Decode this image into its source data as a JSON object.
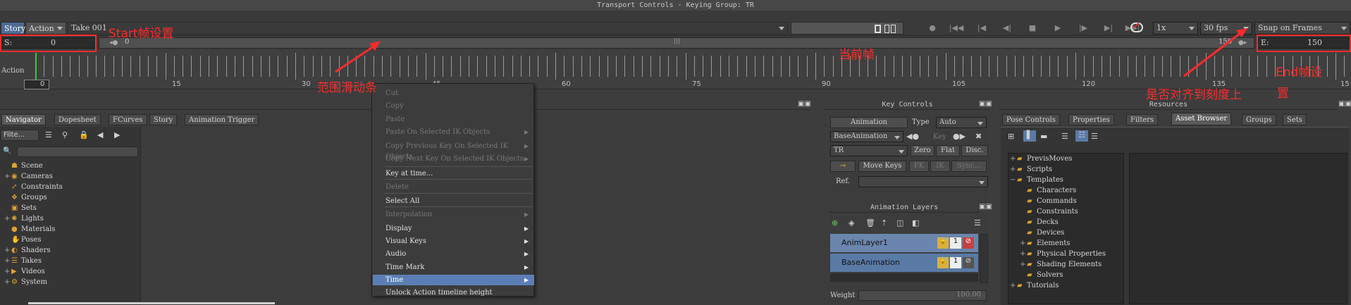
{
  "transport": {
    "title": "Transport Controls  -  Keying Group: TR",
    "story_tab": "Story",
    "action_tab": "Action",
    "take": "Take 001",
    "start_label": "S:",
    "start_value": "0",
    "end_label": "E:",
    "end_value": "150",
    "range_start": "0",
    "range_end": "150",
    "range_mid": "|||",
    "speed": "1x",
    "fps": "30 fps",
    "snap": "Snap on Frames",
    "buttons": {
      "key": "●",
      "to_start": "|◀◀",
      "prev_key": "|◀",
      "prev_frame": "◀|",
      "stop": "■",
      "play": "▶",
      "next_frame": "|▶",
      "next_key": "▶|",
      "to_end": "▶▶|"
    }
  },
  "timeline": {
    "label": "Action",
    "current_frame": "0",
    "ticks": [
      "15",
      "30",
      "45",
      "60",
      "75",
      "90",
      "105",
      "120",
      "135",
      "15"
    ]
  },
  "annotations": {
    "start": "Start帧设置",
    "range": "范围滑动条",
    "current": "当前帧",
    "snap": "是否对齐到刻度上",
    "end_line1": "End帧设",
    "end_line2": "置"
  },
  "navigator": {
    "title": "Navigator",
    "tabs": [
      "Navigator",
      "Dopesheet",
      "FCurves",
      "Story",
      "Animation Trigger"
    ],
    "filter": "Filte...",
    "search_placeholder": "",
    "tree": [
      {
        "label": "Scene",
        "exp": "",
        "icon": "scene-icon"
      },
      {
        "label": "Cameras",
        "exp": "+",
        "icon": "camera-icon"
      },
      {
        "label": "Constraints",
        "exp": "",
        "icon": "constraint-icon"
      },
      {
        "label": "Groups",
        "exp": "",
        "icon": "groups-icon"
      },
      {
        "label": "Sets",
        "exp": "",
        "icon": "sets-icon"
      },
      {
        "label": "Lights",
        "exp": "+",
        "icon": "light-icon"
      },
      {
        "label": "Materials",
        "exp": "",
        "icon": "material-icon"
      },
      {
        "label": "Poses",
        "exp": "",
        "icon": "poses-icon"
      },
      {
        "label": "Shaders",
        "exp": "+",
        "icon": "shader-icon"
      },
      {
        "label": "Takes",
        "exp": "+",
        "icon": "takes-icon"
      },
      {
        "label": "Videos",
        "exp": "+",
        "icon": "video-icon"
      },
      {
        "label": "System",
        "exp": "+",
        "icon": "system-icon"
      }
    ]
  },
  "context_menu": {
    "items": [
      {
        "label": "Cut",
        "disabled": true,
        "sub": false
      },
      {
        "label": "Copy",
        "disabled": true,
        "sub": false
      },
      {
        "label": "Paste",
        "disabled": true,
        "sub": false
      },
      {
        "label": "Paste On Selected IK Objects",
        "disabled": true,
        "sub": true
      },
      {
        "label": "Copy Previous Key On Selected IK Objects",
        "disabled": true,
        "sub": true
      },
      {
        "label": "Copy Next Key On Selected IK Objects",
        "disabled": true,
        "sub": true
      },
      {
        "label": "Key at time...",
        "disabled": false,
        "sub": false
      },
      {
        "label": "Delete",
        "disabled": true,
        "sub": false
      },
      {
        "label": "Select All",
        "disabled": false,
        "sub": false
      },
      {
        "label": "Interpolation",
        "disabled": true,
        "sub": true
      },
      {
        "label": "Display",
        "disabled": false,
        "sub": true
      },
      {
        "label": "Visual Keys",
        "disabled": false,
        "sub": true
      },
      {
        "label": "Audio",
        "disabled": false,
        "sub": true
      },
      {
        "label": "Time Mark",
        "disabled": false,
        "sub": true
      },
      {
        "label": "Time",
        "disabled": false,
        "sub": true,
        "selected": true
      },
      {
        "label": "Unlock Action timeline height",
        "disabled": false,
        "sub": false
      }
    ]
  },
  "key_controls": {
    "title": "Key Controls",
    "mode": "Animation",
    "type_label": "Type",
    "type_value": "Auto",
    "layer": "BaseAnimation",
    "key_label": "Key",
    "group": "TR",
    "zero": "Zero",
    "flat": "Flat",
    "disc": "Disc.",
    "move_keys": "Move Keys",
    "fk": "FK",
    "ik": "IK",
    "sync": "Sync...",
    "ref_label": "Ref.",
    "ref_value": ""
  },
  "animation_layers": {
    "title": "Animation Layers",
    "layers": [
      "AnimLayer1",
      "BaseAnimation"
    ],
    "weight_label": "Weight",
    "weight_value": "100.00"
  },
  "resources": {
    "title": "Resources",
    "tabs": [
      "Pose Controls",
      "Properties",
      "Filters",
      "Asset Browser",
      "Groups",
      "Sets"
    ],
    "active_tab": "Asset Browser",
    "tree": [
      {
        "label": "PrevisMoves",
        "exp": "+",
        "depth": 0
      },
      {
        "label": "Scripts",
        "exp": "+",
        "depth": 0
      },
      {
        "label": "Templates",
        "exp": "−",
        "depth": 0
      },
      {
        "label": "Characters",
        "exp": "",
        "depth": 1
      },
      {
        "label": "Commands",
        "exp": "",
        "depth": 1
      },
      {
        "label": "Constraints",
        "exp": "",
        "depth": 1
      },
      {
        "label": "Decks",
        "exp": "",
        "depth": 1
      },
      {
        "label": "Devices",
        "exp": "",
        "depth": 1
      },
      {
        "label": "Elements",
        "exp": "+",
        "depth": 1
      },
      {
        "label": "Physical Properties",
        "exp": "+",
        "depth": 1
      },
      {
        "label": "Shading Elements",
        "exp": "+",
        "depth": 1
      },
      {
        "label": "Solvers",
        "exp": "",
        "depth": 1
      },
      {
        "label": "Tutorials",
        "exp": "+",
        "depth": 0
      }
    ]
  },
  "colors": {
    "accent": "#5b7fb5",
    "annotation": "#ff2b2b",
    "layer_blue": "#5a7aa6"
  }
}
